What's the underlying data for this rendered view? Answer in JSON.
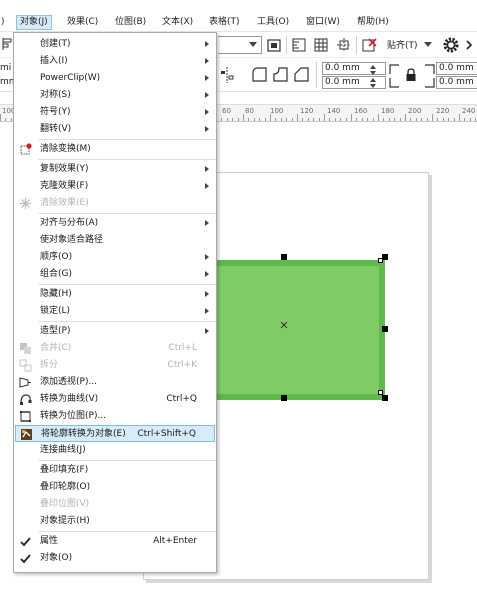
{
  "menubar": {
    "items": [
      {
        "label": "对象(J)",
        "active": true
      },
      {
        "label": "效果(C)"
      },
      {
        "label": "位图(B)"
      },
      {
        "label": "文本(X)"
      },
      {
        "label": "表格(T)"
      },
      {
        "label": "工具(O)"
      },
      {
        "label": "窗口(W)"
      },
      {
        "label": "帮助(H)"
      }
    ],
    "partial_left": ")"
  },
  "toolbar": {
    "snap_label": "贴齐(T)",
    "unit_partial_1": "mi",
    "unit_partial_2": "mm",
    "offset1": "0.0 mm",
    "offset2": "0.0 mm",
    "offset3": "0.0 mm",
    "offset4": "0.0 mm"
  },
  "ruler": {
    "labels": [
      "100",
      "60",
      "80",
      "100",
      "120",
      "140",
      "160",
      "180",
      "200",
      "220",
      "240"
    ]
  },
  "menu": {
    "items": [
      {
        "label": "创建(T)",
        "submenu": true
      },
      {
        "label": "插入(I)",
        "submenu": true
      },
      {
        "label": "PowerClip(W)",
        "submenu": true
      },
      {
        "label": "对称(S)",
        "submenu": true
      },
      {
        "label": "符号(Y)",
        "submenu": true
      },
      {
        "label": "翻转(V)",
        "submenu": true
      },
      {
        "label": "清除变换(M)",
        "icon": "clear-transform-icon"
      },
      {
        "label": "复制效果(Y)",
        "submenu": true
      },
      {
        "label": "克隆效果(F)",
        "submenu": true
      },
      {
        "label": "清除效果(E)",
        "disabled": true,
        "icon": "clear-effect-icon"
      },
      {
        "label": "对齐与分布(A)",
        "submenu": true
      },
      {
        "label": "使对象适合路径"
      },
      {
        "label": "顺序(O)",
        "submenu": true
      },
      {
        "label": "组合(G)",
        "submenu": true
      },
      {
        "label": "隐藏(H)",
        "submenu": true
      },
      {
        "label": "锁定(L)",
        "submenu": true
      },
      {
        "label": "造型(P)",
        "submenu": true
      },
      {
        "label": "合并(C)",
        "disabled": true,
        "shortcut": "Ctrl+L",
        "icon": "combine-icon"
      },
      {
        "label": "拆分",
        "disabled": true,
        "shortcut": "Ctrl+K",
        "icon": "break-apart-icon"
      },
      {
        "label": "添加透视(P)...",
        "icon": "perspective-icon"
      },
      {
        "label": "转换为曲线(V)",
        "shortcut": "Ctrl+Q",
        "icon": "convert-curves-icon"
      },
      {
        "label": "转换为位图(P)...",
        "icon": "convert-bitmap-icon"
      },
      {
        "label": "将轮廓转换为对象(E)",
        "shortcut": "Ctrl+Shift+Q",
        "highlighted": true,
        "icon": "outline-to-object-icon"
      },
      {
        "label": "连接曲线(J)"
      },
      {
        "label": "叠印填充(F)"
      },
      {
        "label": "叠印轮廓(O)"
      },
      {
        "label": "叠印位图(V)",
        "disabled": true
      },
      {
        "label": "对象提示(H)"
      },
      {
        "label": "属性",
        "shortcut": "Alt+Enter",
        "checked": true
      },
      {
        "label": "对象(O)",
        "checked": true
      }
    ]
  },
  "colors": {
    "rectangle_fill": "#7fcc67",
    "rectangle_outline": "#5fb94b",
    "menu_highlight": "#d7ecf8",
    "menu_highlight_border": "#7fbde3"
  }
}
